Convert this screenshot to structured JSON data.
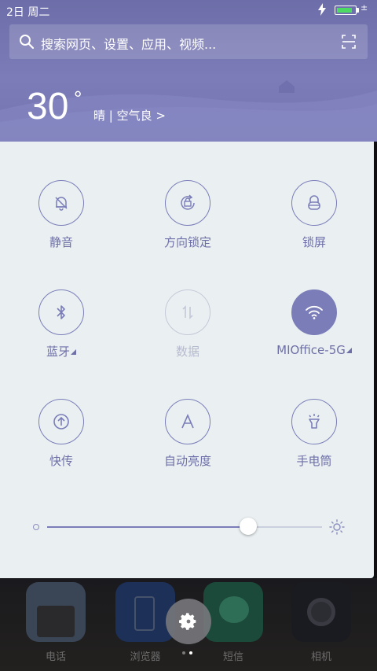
{
  "status_bar": {
    "date": "2日 周二",
    "battery_level": 0.9,
    "battery_plus": "±"
  },
  "search": {
    "placeholder": "搜索网页、设置、应用、视频..."
  },
  "weather": {
    "temperature": "30",
    "unit": "°",
    "description": "晴 | 空气良 >"
  },
  "toggles": [
    {
      "label": "静音",
      "icon": "mute-bell-icon",
      "state": "off"
    },
    {
      "label": "方向锁定",
      "icon": "rotation-lock-icon",
      "state": "off"
    },
    {
      "label": "锁屏",
      "icon": "lock-icon",
      "state": "off"
    },
    {
      "label": "蓝牙",
      "icon": "bluetooth-icon",
      "state": "off",
      "has_more": true
    },
    {
      "label": "数据",
      "icon": "mobile-data-icon",
      "state": "disabled"
    },
    {
      "label": "MIOffice-5G",
      "icon": "wifi-icon",
      "state": "on",
      "has_more": true
    },
    {
      "label": "快传",
      "icon": "quick-transfer-icon",
      "state": "off"
    },
    {
      "label": "自动亮度",
      "icon": "auto-brightness-icon",
      "state": "off"
    },
    {
      "label": "手电筒",
      "icon": "flashlight-icon",
      "state": "off"
    }
  ],
  "brightness": {
    "level": 0.73
  },
  "dock": {
    "apps": [
      {
        "label": "电话",
        "icon": "phone-app-icon"
      },
      {
        "label": "浏览器",
        "icon": "browser-app-icon"
      },
      {
        "label": "短信",
        "icon": "messages-app-icon"
      },
      {
        "label": "相机",
        "icon": "camera-app-icon"
      }
    ],
    "settings_icon": "gear-icon",
    "page_count": 2,
    "current_page": 2
  },
  "colors": {
    "accent": "#7b7db8",
    "panel_bg": "#eaf0f2",
    "header_bg": "#7474b1",
    "battery_green": "#4cd964"
  }
}
